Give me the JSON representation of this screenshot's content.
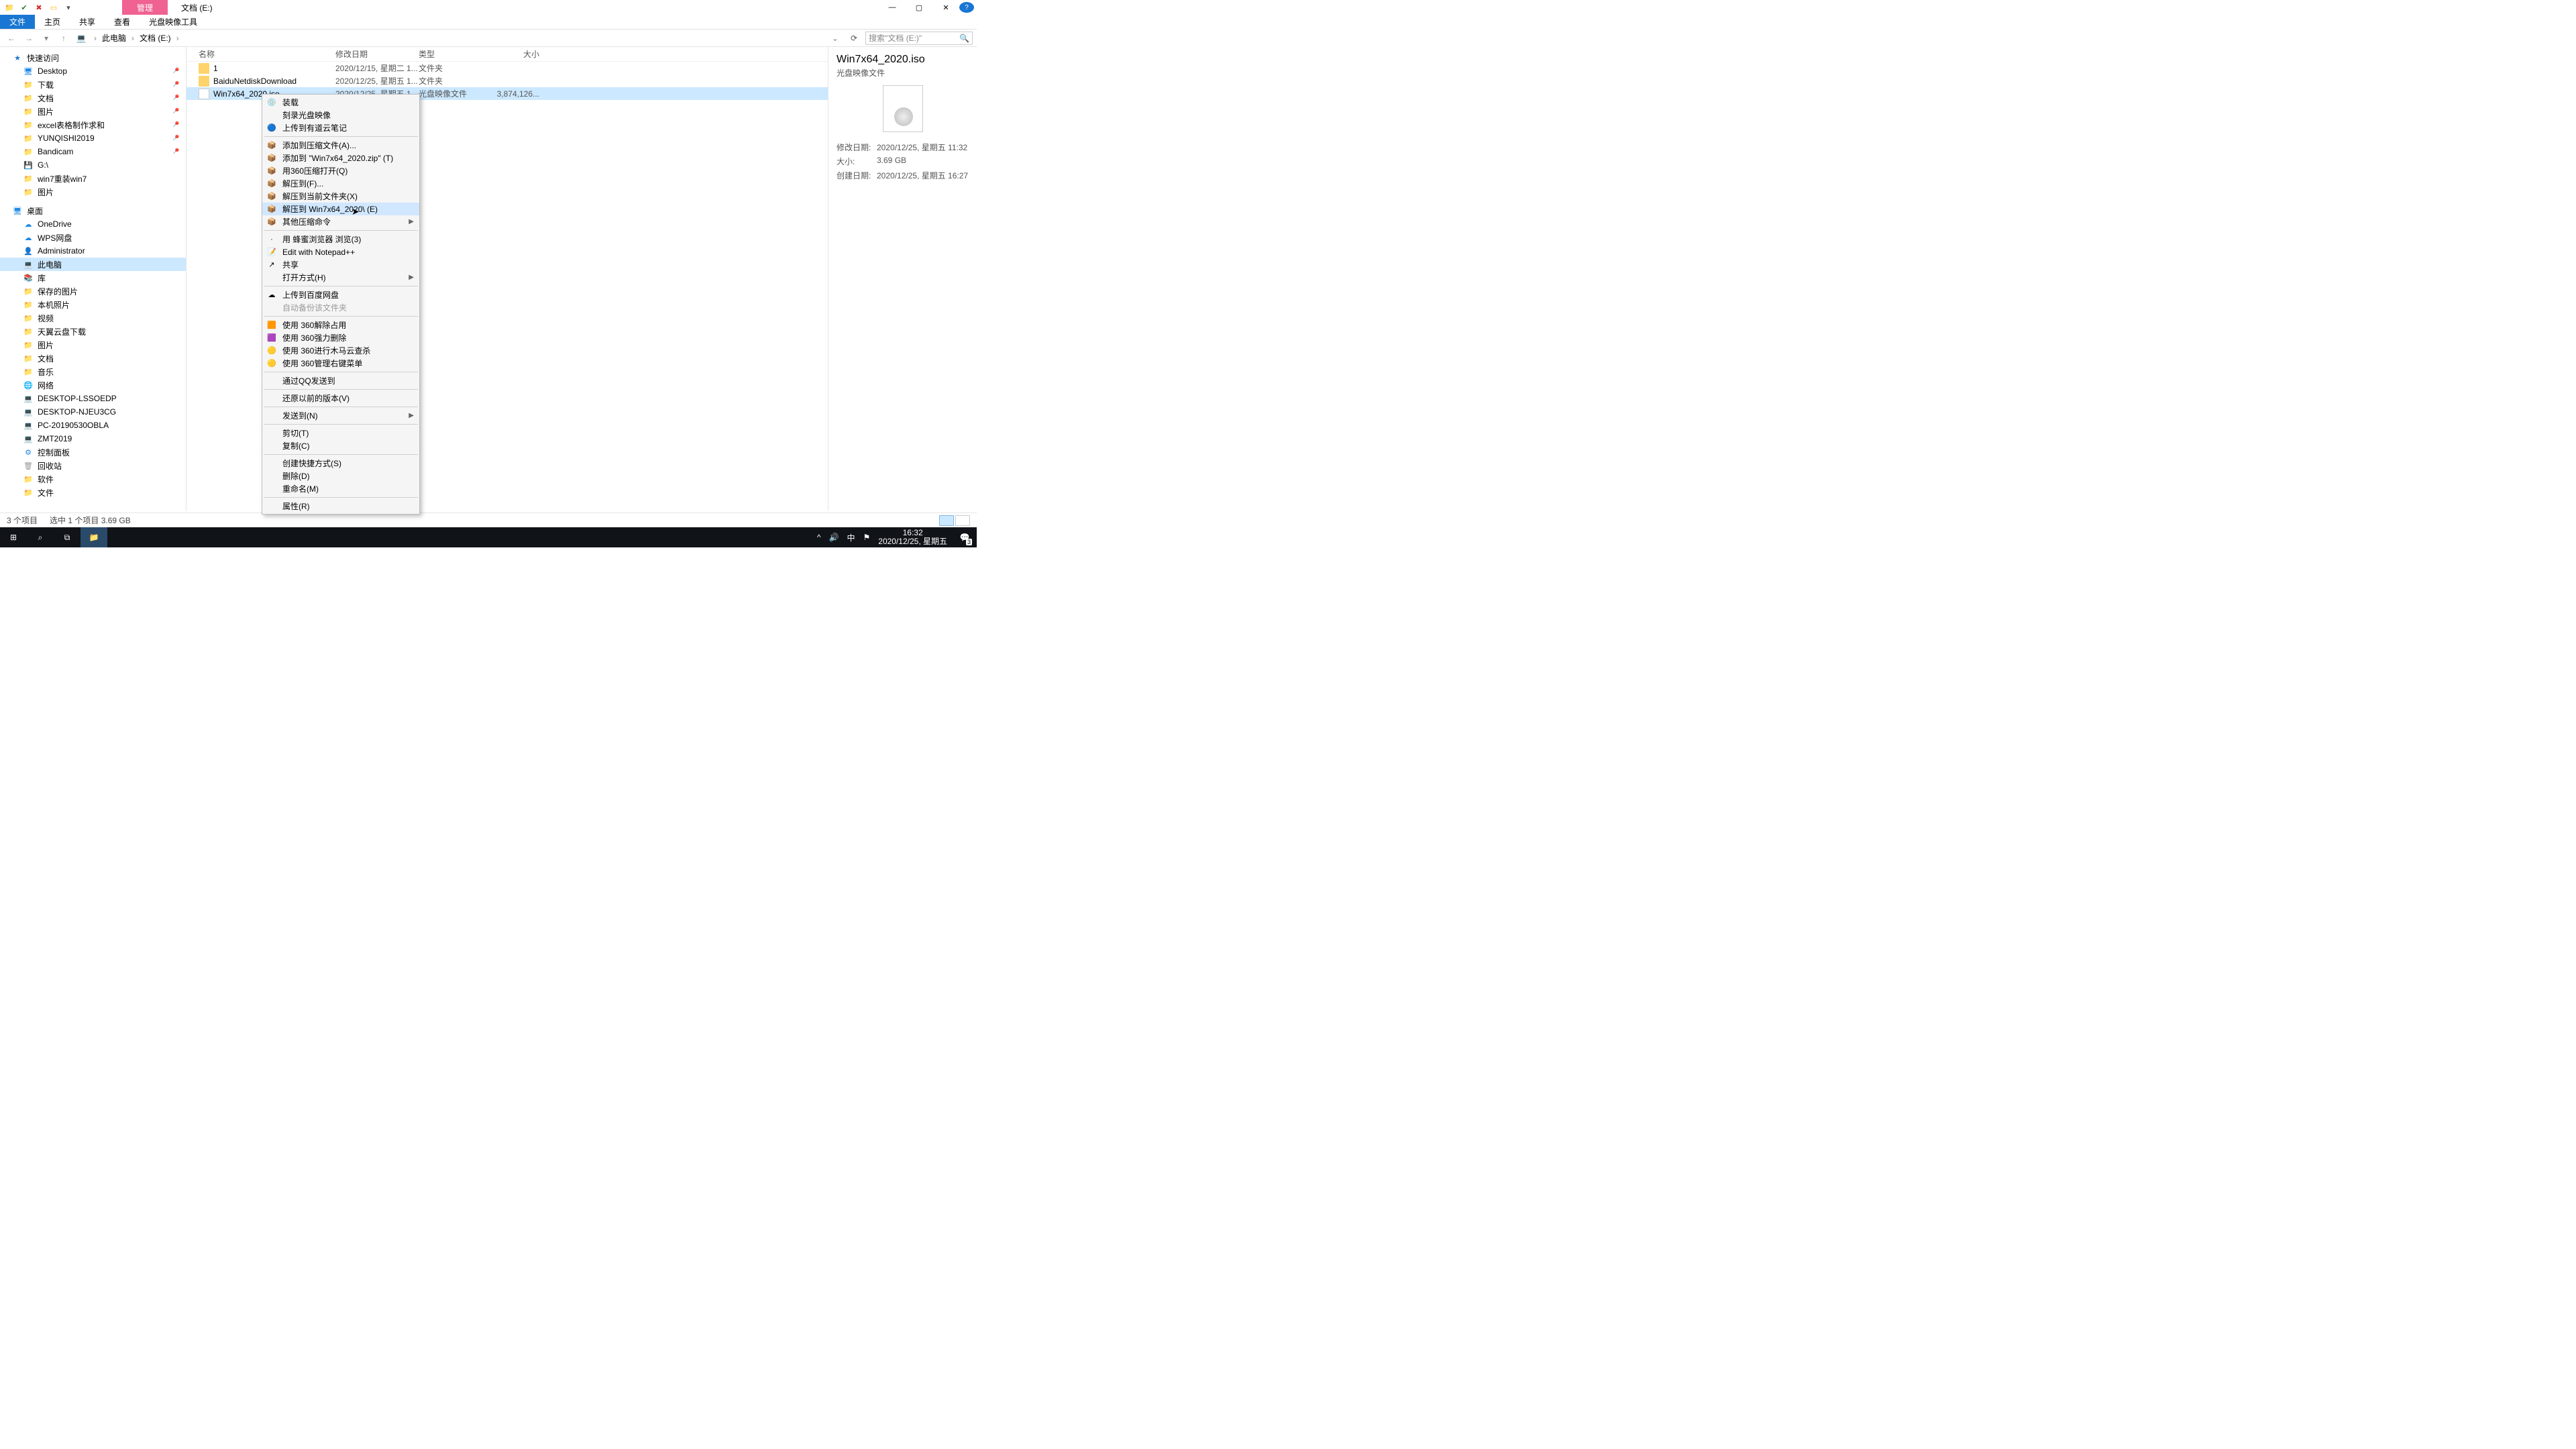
{
  "window": {
    "title": "文档 (E:)",
    "manage_tab": "管理"
  },
  "ribbon": {
    "file": "文件",
    "home": "主页",
    "share": "共享",
    "view": "查看",
    "disc": "光盘映像工具"
  },
  "addr": {
    "root": "此电脑",
    "folder": "文档 (E:)",
    "search_ph": "搜索\"文档 (E:)\""
  },
  "tree": {
    "quick": "快速访问",
    "quick_items": [
      "Desktop",
      "下载",
      "文档",
      "图片",
      "excel表格制作求和",
      "YUNQISHI2019",
      "Bandicam",
      "G:\\",
      "win7重装win7",
      "图片"
    ],
    "desktop": "桌面",
    "desktop_items": [
      "OneDrive",
      "WPS网盘",
      "Administrator",
      "此电脑",
      "库"
    ],
    "lib_items": [
      "保存的图片",
      "本机照片",
      "视频",
      "天翼云盘下载",
      "图片",
      "文档",
      "音乐"
    ],
    "network": "网络",
    "net_items": [
      "DESKTOP-LSSOEDP",
      "DESKTOP-NJEU3CG",
      "PC-20190530OBLA",
      "ZMT2019"
    ],
    "ctrl": "控制面板",
    "recycle": "回收站",
    "soft": "软件",
    "files": "文件"
  },
  "cols": {
    "name": "名称",
    "date": "修改日期",
    "type": "类型",
    "size": "大小"
  },
  "rows": [
    {
      "name": "1",
      "date": "2020/12/15, 星期二 1...",
      "type": "文件夹",
      "size": ""
    },
    {
      "name": "BaiduNetdiskDownload",
      "date": "2020/12/25, 星期五 1...",
      "type": "文件夹",
      "size": ""
    },
    {
      "name": "Win7x64_2020.iso",
      "date": "2020/12/25, 星期五 1...",
      "type": "光盘映像文件",
      "size": "3,874,126..."
    }
  ],
  "details": {
    "title": "Win7x64_2020.iso",
    "sub": "光盘映像文件",
    "mod_k": "修改日期:",
    "mod_v": "2020/12/25, 星期五 11:32",
    "size_k": "大小:",
    "size_v": "3.69 GB",
    "cre_k": "创建日期:",
    "cre_v": "2020/12/25, 星期五 16:27"
  },
  "status": {
    "count": "3 个项目",
    "sel": "选中 1 个项目  3.69 GB"
  },
  "ctx": [
    {
      "t": "装载",
      "ic": "💿"
    },
    {
      "t": "刻录光盘映像"
    },
    {
      "t": "上传到有道云笔记",
      "ic": "🔵"
    },
    {
      "sep": true
    },
    {
      "t": "添加到压缩文件(A)...",
      "ic": "📦"
    },
    {
      "t": "添加到 \"Win7x64_2020.zip\" (T)",
      "ic": "📦"
    },
    {
      "t": "用360压缩打开(Q)",
      "ic": "📦"
    },
    {
      "t": "解压到(F)...",
      "ic": "📦"
    },
    {
      "t": "解压到当前文件夹(X)",
      "ic": "📦"
    },
    {
      "t": "解压到 Win7x64_2020\\ (E)",
      "ic": "📦",
      "hover": true
    },
    {
      "t": "其他压缩命令",
      "ic": "📦",
      "sub": true
    },
    {
      "sep": true
    },
    {
      "t": "用 蜂蜜浏览器 浏览(3)",
      "ic": "·"
    },
    {
      "t": "Edit with Notepad++",
      "ic": "📝"
    },
    {
      "t": "共享",
      "ic": "↗"
    },
    {
      "t": "打开方式(H)",
      "sub": true
    },
    {
      "sep": true
    },
    {
      "t": "上传到百度网盘",
      "ic": "☁"
    },
    {
      "t": "自动备份该文件夹",
      "disabled": true
    },
    {
      "sep": true
    },
    {
      "t": "使用 360解除占用",
      "ic": "🟧"
    },
    {
      "t": "使用 360强力删除",
      "ic": "🟪"
    },
    {
      "t": "使用 360进行木马云查杀",
      "ic": "🟡"
    },
    {
      "t": "使用 360管理右键菜单",
      "ic": "🟡"
    },
    {
      "sep": true
    },
    {
      "t": "通过QQ发送到"
    },
    {
      "sep": true
    },
    {
      "t": "还原以前的版本(V)"
    },
    {
      "sep": true
    },
    {
      "t": "发送到(N)",
      "sub": true
    },
    {
      "sep": true
    },
    {
      "t": "剪切(T)"
    },
    {
      "t": "复制(C)"
    },
    {
      "sep": true
    },
    {
      "t": "创建快捷方式(S)"
    },
    {
      "t": "删除(D)"
    },
    {
      "t": "重命名(M)"
    },
    {
      "sep": true
    },
    {
      "t": "属性(R)"
    }
  ],
  "taskbar": {
    "time": "16:32",
    "date": "2020/12/25, 星期五",
    "ime": "中",
    "notif": "3"
  }
}
